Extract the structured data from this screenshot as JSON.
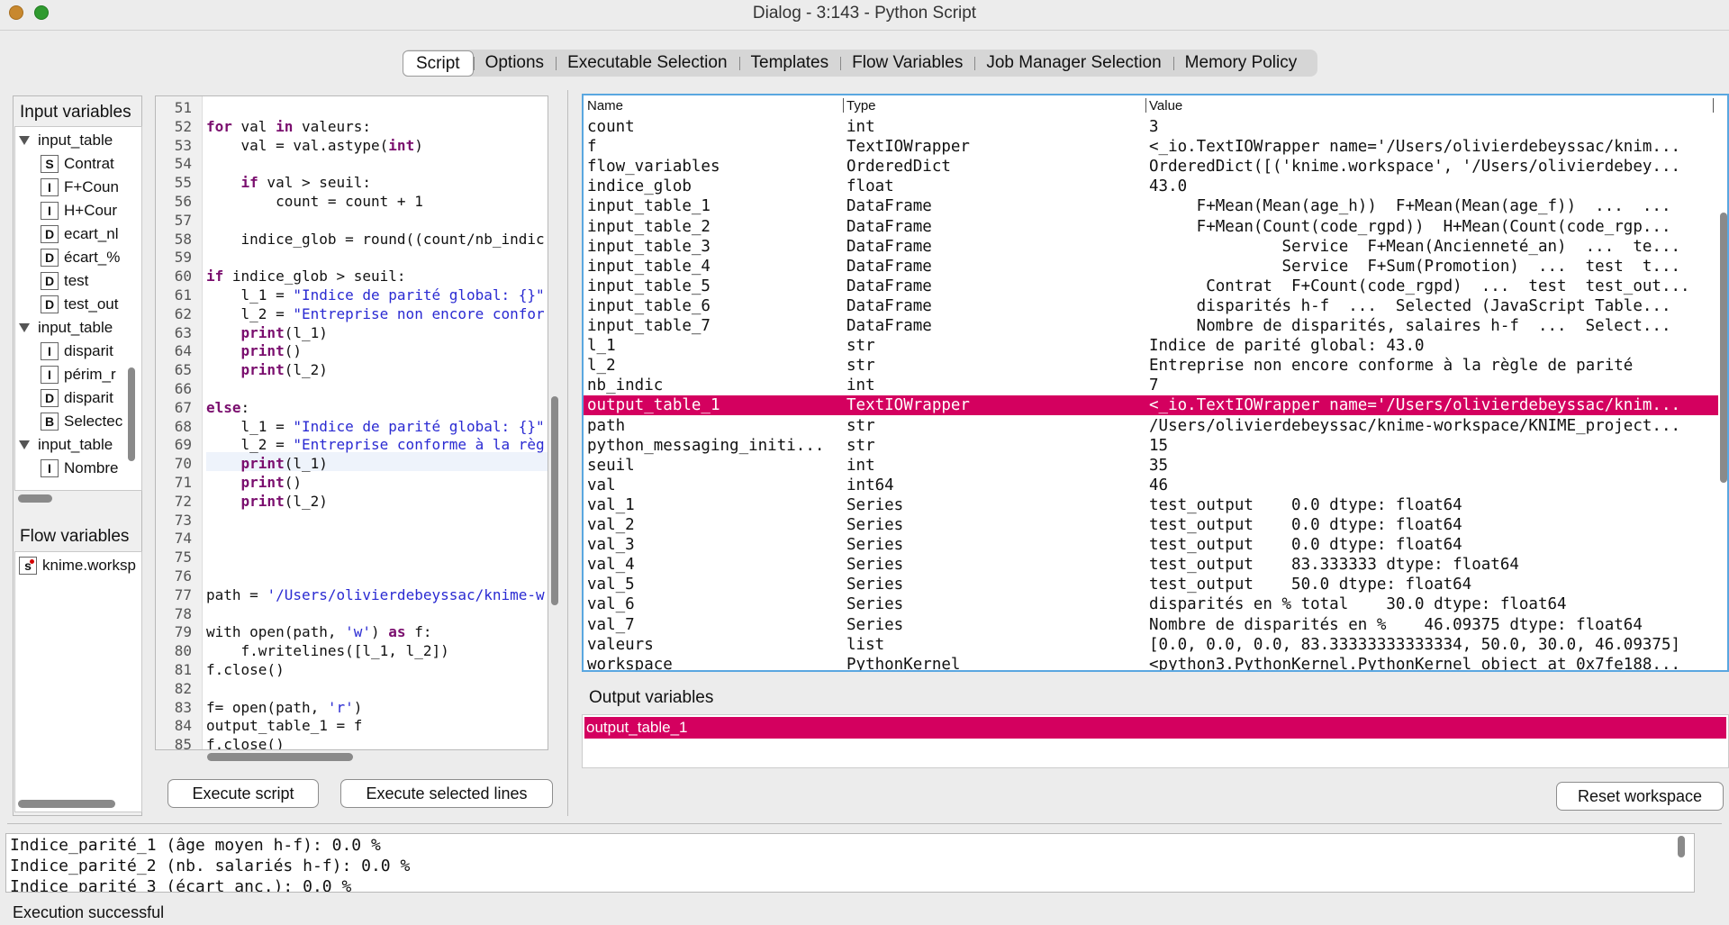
{
  "window": {
    "title": "Dialog - 3:143 - Python Script"
  },
  "tabs": [
    {
      "label": "Script",
      "active": true
    },
    {
      "label": "Options"
    },
    {
      "label": "Executable Selection"
    },
    {
      "label": "Templates"
    },
    {
      "label": "Flow Variables"
    },
    {
      "label": "Job Manager Selection"
    },
    {
      "label": "Memory Policy"
    }
  ],
  "input_variables": {
    "header": "Input variables",
    "items": [
      {
        "kind": "group",
        "label": "input_table"
      },
      {
        "kind": "S",
        "label": "Contrat"
      },
      {
        "kind": "I",
        "label": "F+Coun"
      },
      {
        "kind": "I",
        "label": "H+Cour"
      },
      {
        "kind": "D",
        "label": "ecart_nl"
      },
      {
        "kind": "D",
        "label": "écart_%"
      },
      {
        "kind": "D",
        "label": "test"
      },
      {
        "kind": "D",
        "label": "test_out"
      },
      {
        "kind": "group",
        "label": "input_table"
      },
      {
        "kind": "I",
        "label": "disparit"
      },
      {
        "kind": "I",
        "label": "périm_r"
      },
      {
        "kind": "D",
        "label": "disparit"
      },
      {
        "kind": "B",
        "label": "Selectec"
      },
      {
        "kind": "group",
        "label": "input_table"
      },
      {
        "kind": "I",
        "label": "Nombre"
      }
    ]
  },
  "flow_variables": {
    "header": "Flow variables",
    "items": [
      {
        "kind": "s",
        "label": "knime.worksp"
      }
    ]
  },
  "code_lines": [
    {
      "n": "51",
      "html": ""
    },
    {
      "n": "52",
      "html": "<span class='kw'>for</span> val <span class='kw'>in</span> valeurs:"
    },
    {
      "n": "53",
      "html": "    val = val.astype(<span class='kw'>int</span>)"
    },
    {
      "n": "54",
      "html": ""
    },
    {
      "n": "55",
      "html": "    <span class='kw'>if</span> val &gt; seuil:"
    },
    {
      "n": "56",
      "html": "        count = count + 1"
    },
    {
      "n": "57",
      "html": ""
    },
    {
      "n": "58",
      "html": "    indice_glob = round((count/nb_indic"
    },
    {
      "n": "59",
      "html": ""
    },
    {
      "n": "60",
      "html": "<span class='kw'>if</span> indice_glob &gt; seuil:"
    },
    {
      "n": "61",
      "html": "    l_1 = <span class='str'>\"Indice de parité global: {}\"</span>"
    },
    {
      "n": "62",
      "html": "    l_2 = <span class='str'>\"Entreprise non encore confor</span>"
    },
    {
      "n": "63",
      "html": "    <span class='kw'>print</span>(l_1)"
    },
    {
      "n": "64",
      "html": "    <span class='kw'>print</span>()"
    },
    {
      "n": "65",
      "html": "    <span class='kw'>print</span>(l_2)"
    },
    {
      "n": "66",
      "html": ""
    },
    {
      "n": "67",
      "html": "<span class='kw'>else</span>:"
    },
    {
      "n": "68",
      "html": "    l_1 = <span class='str'>\"Indice de parité global: {}\"</span>"
    },
    {
      "n": "69",
      "html": "    l_2 = <span class='str'>\"Entreprise conforme à la règ</span>"
    },
    {
      "n": "70",
      "html": "    <span class='kw'>print</span>(l_1)"
    },
    {
      "n": "71",
      "html": "    <span class='kw'>print</span>()"
    },
    {
      "n": "72",
      "html": "    <span class='kw'>print</span>(l_2)"
    },
    {
      "n": "73",
      "html": ""
    },
    {
      "n": "74",
      "html": ""
    },
    {
      "n": "75",
      "html": ""
    },
    {
      "n": "76",
      "html": ""
    },
    {
      "n": "77",
      "html": "path = <span class='str'>'/Users/olivierdebeyssac/knime-w</span>"
    },
    {
      "n": "78",
      "html": ""
    },
    {
      "n": "79",
      "html": "with open(path, <span class='str'>'w'</span>) <span class='kw'>as</span> f:"
    },
    {
      "n": "80",
      "html": "    f.writelines([l_1, l_2])"
    },
    {
      "n": "81",
      "html": "f.close()"
    },
    {
      "n": "82",
      "html": ""
    },
    {
      "n": "83",
      "html": "f= open(path, <span class='str'>'r'</span>)"
    },
    {
      "n": "84",
      "html": "output_table_1 = f"
    },
    {
      "n": "85",
      "html": "f.close()"
    }
  ],
  "buttons": {
    "execute_script": "Execute script",
    "execute_selected": "Execute selected lines",
    "reset_workspace": "Reset workspace"
  },
  "var_table": {
    "columns": [
      "Name",
      "Type",
      "Value"
    ],
    "rows": [
      [
        "count",
        "int",
        "3"
      ],
      [
        "f",
        "TextIOWrapper",
        "<_io.TextIOWrapper name='/Users/olivierdebeyssac/knim..."
      ],
      [
        "flow_variables",
        "OrderedDict",
        "OrderedDict([('knime.workspace', '/Users/olivierdebey..."
      ],
      [
        "indice_glob",
        "float",
        "43.0"
      ],
      [
        "input_table_1",
        "DataFrame",
        "     F+Mean(Mean(age_h))  F+Mean(Mean(age_f))  ...  ..."
      ],
      [
        "input_table_2",
        "DataFrame",
        "     F+Mean(Count(code_rgpd))  H+Mean(Count(code_rgp..."
      ],
      [
        "input_table_3",
        "DataFrame",
        "              Service  F+Mean(Ancienneté_an)  ...  te..."
      ],
      [
        "input_table_4",
        "DataFrame",
        "              Service  F+Sum(Promotion)  ...  test  t..."
      ],
      [
        "input_table_5",
        "DataFrame",
        "      Contrat  F+Count(code_rgpd)  ...  test  test_out..."
      ],
      [
        "input_table_6",
        "DataFrame",
        "     disparités h-f  ...  Selected (JavaScript Table..."
      ],
      [
        "input_table_7",
        "DataFrame",
        "     Nombre de disparités, salaires h-f  ...  Select..."
      ],
      [
        "l_1",
        "str",
        "Indice de parité global: 43.0"
      ],
      [
        "l_2",
        "str",
        "Entreprise non encore conforme à la règle de parité"
      ],
      [
        "nb_indic",
        "int",
        "7"
      ],
      [
        "output_table_1",
        "TextIOWrapper",
        "<_io.TextIOWrapper name='/Users/olivierdebeyssac/knim..."
      ],
      [
        "path",
        "str",
        "/Users/olivierdebeyssac/knime-workspace/KNIME_project..."
      ],
      [
        "python_messaging_initi...",
        "str",
        "15"
      ],
      [
        "seuil",
        "int",
        "35"
      ],
      [
        "val",
        "int64",
        "46"
      ],
      [
        "val_1",
        "Series",
        "test_output    0.0 dtype: float64"
      ],
      [
        "val_2",
        "Series",
        "test_output    0.0 dtype: float64"
      ],
      [
        "val_3",
        "Series",
        "test_output    0.0 dtype: float64"
      ],
      [
        "val_4",
        "Series",
        "test_output    83.333333 dtype: float64"
      ],
      [
        "val_5",
        "Series",
        "test_output    50.0 dtype: float64"
      ],
      [
        "val_6",
        "Series",
        "disparités en % total    30.0 dtype: float64"
      ],
      [
        "val_7",
        "Series",
        "Nombre de disparités en %    46.09375 dtype: float64"
      ],
      [
        "valeurs",
        "list",
        "[0.0, 0.0, 0.0, 83.33333333333334, 50.0, 30.0, 46.09375]"
      ],
      [
        "workspace",
        "PythonKernel",
        "<python3.PythonKernel.PythonKernel object at 0x7fe188..."
      ]
    ],
    "selected_index": 14
  },
  "output_variables": {
    "header": "Output variables",
    "items": [
      "output_table_1"
    ]
  },
  "console": {
    "lines": [
      "Indice_parité_1 (âge moyen h-f): 0.0 %",
      "Indice_parité_2 (nb. salariés h-f): 0.0 %",
      "Indice_parité_3 (écart_anc.): 0.0 %"
    ]
  },
  "status": "Execution successful",
  "colors": {
    "selection": "#d4005f",
    "keyword": "#7a0e6e",
    "string": "#2a2ad2"
  }
}
